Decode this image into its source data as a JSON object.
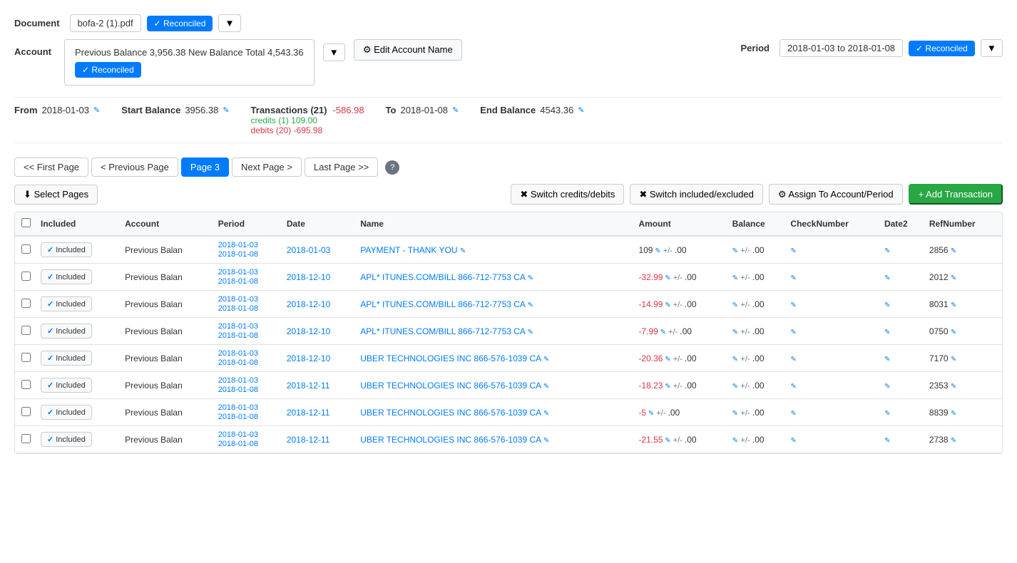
{
  "document": {
    "label": "Document",
    "filename": "bofa-2 (1).pdf",
    "reconciled_label": "✓ Reconciled"
  },
  "account": {
    "label": "Account",
    "text": "Previous Balance 3,956.38 New Balance Total 4,543.36",
    "reconciled_label": "✓ Reconciled",
    "edit_btn": "⚙ Edit Account Name",
    "dropdown_label": "Previous Balan"
  },
  "period": {
    "label": "Period",
    "value": "2018-01-03 to 2018-01-08",
    "reconciled_label": "✓ Reconciled"
  },
  "stats": {
    "from_label": "From",
    "from_value": "2018-01-03",
    "start_balance_label": "Start Balance",
    "start_balance_value": "3956.38",
    "transactions_label": "Transactions (21)",
    "transactions_value": "-586.98",
    "credits_label": "credits (1) 109.00",
    "debits_label": "debits (20) -695.98",
    "to_label": "To",
    "to_value": "2018-01-08",
    "end_balance_label": "End Balance",
    "end_balance_value": "4543.36"
  },
  "pagination": {
    "first": "<< First Page",
    "prev": "< Previous Page",
    "current": "Page 3",
    "next": "Next Page >",
    "last": "Last Page >>"
  },
  "actions": {
    "select_pages": "⬇ Select Pages",
    "switch_credits": "✖ Switch credits/debits",
    "switch_included": "✖ Switch included/excluded",
    "assign": "⚙ Assign To Account/Period",
    "add_transaction": "+ Add Transaction"
  },
  "table": {
    "columns": [
      "Included",
      "Account",
      "Period",
      "Date",
      "Name",
      "Amount",
      "Balance",
      "CheckNumber",
      "Date2",
      "RefNumber"
    ],
    "rows": [
      {
        "included": true,
        "account": "Previous Balan",
        "period_start": "2018-01-03",
        "period_end": "2018-01-08",
        "date": "2018-01-03",
        "name": "PAYMENT - THANK YOU",
        "amount": "109",
        "amount_negative": false,
        "balance_edit": true,
        "ref": "2856"
      },
      {
        "included": true,
        "account": "Previous Balan",
        "period_start": "2018-01-03",
        "period_end": "2018-01-08",
        "date": "2018-12-10",
        "name": "APL* ITUNES.COM/BILL 866-712-7753 CA",
        "amount": "-32.99",
        "amount_negative": true,
        "balance_edit": true,
        "ref": "2012"
      },
      {
        "included": true,
        "account": "Previous Balan",
        "period_start": "2018-01-03",
        "period_end": "2018-01-08",
        "date": "2018-12-10",
        "name": "APL* ITUNES.COM/BILL 866-712-7753 CA",
        "amount": "-14.99",
        "amount_negative": true,
        "balance_edit": true,
        "ref": "8031"
      },
      {
        "included": true,
        "account": "Previous Balan",
        "period_start": "2018-01-03",
        "period_end": "2018-01-08",
        "date": "2018-12-10",
        "name": "APL* ITUNES.COM/BILL 866-712-7753 CA",
        "amount": "-7.99",
        "amount_negative": true,
        "balance_edit": true,
        "ref": "0750"
      },
      {
        "included": true,
        "account": "Previous Balan",
        "period_start": "2018-01-03",
        "period_end": "2018-01-08",
        "date": "2018-12-10",
        "name": "UBER TECHNOLOGIES INC 866-576-1039 CA",
        "amount": "-20.36",
        "amount_negative": true,
        "balance_edit": true,
        "ref": "7170"
      },
      {
        "included": true,
        "account": "Previous Balan",
        "period_start": "2018-01-03",
        "period_end": "2018-01-08",
        "date": "2018-12-11",
        "name": "UBER TECHNOLOGIES INC 866-576-1039 CA",
        "amount": "-18.23",
        "amount_negative": true,
        "balance_edit": true,
        "ref": "2353"
      },
      {
        "included": true,
        "account": "Previous Balan",
        "period_start": "2018-01-03",
        "period_end": "2018-01-08",
        "date": "2018-12-11",
        "name": "UBER TECHNOLOGIES INC 866-576-1039 CA",
        "amount": "-5",
        "amount_negative": true,
        "balance_edit": true,
        "ref": "8839"
      },
      {
        "included": true,
        "account": "Previous Balan",
        "period_start": "2018-01-03",
        "period_end": "2018-01-08",
        "date": "2018-12-11",
        "name": "UBER TECHNOLOGIES INC 866-576-1039 CA",
        "amount": "-21.55",
        "amount_negative": true,
        "balance_edit": true,
        "ref": "2738"
      }
    ]
  }
}
